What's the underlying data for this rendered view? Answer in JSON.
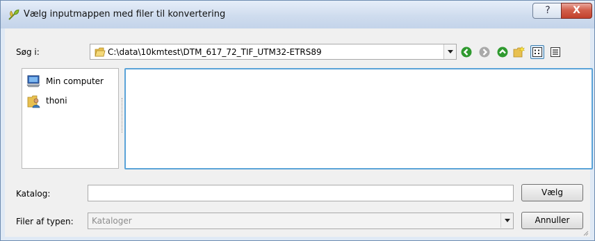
{
  "window": {
    "title": "Vælg inputmappen med filer til konvertering",
    "help_label": "?",
    "close_label": "X"
  },
  "lookin": {
    "label": "Søg i:",
    "path": "C:\\data\\10kmtest\\DTM_617_72_TIF_UTM32-ETRS89"
  },
  "toolbar": {
    "icons": [
      "back-icon",
      "forward-icon",
      "up-folder-icon",
      "new-folder-icon",
      "list-view-icon",
      "detail-view-icon"
    ]
  },
  "sidebar": {
    "items": [
      {
        "label": "Min computer",
        "icon": "computer-icon"
      },
      {
        "label": "thoni",
        "icon": "user-folder-icon"
      }
    ]
  },
  "katalog": {
    "label": "Katalog:",
    "value": "",
    "button": "Vælg"
  },
  "filetype": {
    "label": "Filer af typen:",
    "value": "Kataloger",
    "button": "Annuller"
  },
  "colors": {
    "accent": "#5aa3d8",
    "nav_green": "#2f9a2f"
  }
}
